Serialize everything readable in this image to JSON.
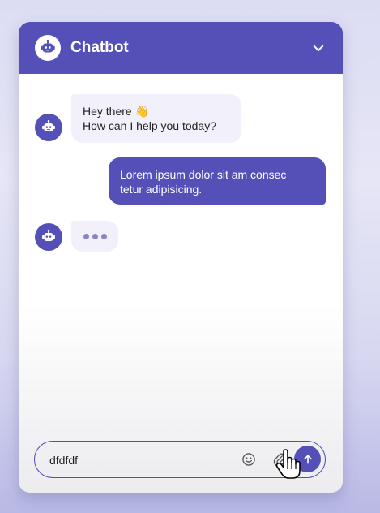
{
  "header": {
    "title": "Chatbot",
    "logo_icon": "robot-icon",
    "collapse_icon": "chevron-down-icon"
  },
  "messages": [
    {
      "sender": "bot",
      "line1": "Hey there 👋",
      "line2": "How can I help you today?"
    },
    {
      "sender": "user",
      "line1": "Lorem ipsum dolor sit am consec",
      "line2": "tetur adipisicing."
    },
    {
      "sender": "bot",
      "typing": true
    }
  ],
  "composer": {
    "input_value": "dfdfdf",
    "emoji_icon": "smiley-icon",
    "attach_icon": "paperclip-icon",
    "send_icon": "arrow-up-icon"
  },
  "colors": {
    "accent": "#5550b8",
    "bot_bubble": "#f1f0fb",
    "background": "#dcdcf3"
  }
}
